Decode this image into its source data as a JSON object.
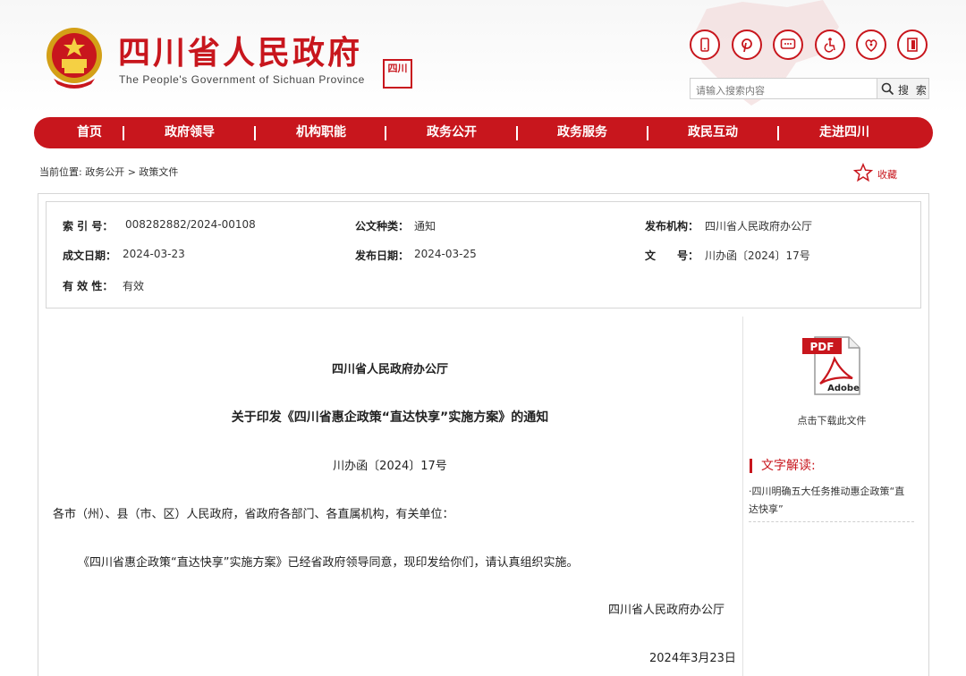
{
  "header": {
    "title": "四川省人民政府",
    "subtitle": "The People's Government of Sichuan Province",
    "seal_text": "四川",
    "icons": [
      "mobile-icon",
      "pinterest-like-icon",
      "message-icon",
      "accessibility-icon",
      "elderly-care-icon",
      "exit-icon"
    ],
    "search_placeholder": "请输入搜索内容",
    "search_label": "搜 索"
  },
  "nav": {
    "items": [
      "首页",
      "政府领导",
      "机构职能",
      "政务公开",
      "政务服务",
      "政民互动",
      "走进四川"
    ]
  },
  "breadcrumb": "当前位置: 政务公开 > 政策文件",
  "favorite_label": "收藏",
  "meta": {
    "index_key": "索 引 号：",
    "index_val": "008282882/2024-00108",
    "type_key": "公文种类：",
    "type_val": "通知",
    "issuer_key": "发布机构：",
    "issuer_val": "四川省人民政府办公厅",
    "written_key": "成文日期：",
    "written_val": "2024-03-23",
    "published_key": "发布日期：",
    "published_val": "2024-03-25",
    "docno_key": "文　　号：",
    "docno_val": "川办函〔2024〕17号",
    "valid_key": "有 效 性：",
    "valid_val": "有效"
  },
  "document": {
    "issuer": "四川省人民政府办公厅",
    "title": "关于印发《四川省惠企政策“直达快享”实施方案》的通知",
    "doc_number": "川办函〔2024〕17号",
    "recipients": "各市（州）、县（市、区）人民政府，省政府各部门、各直属机构，有关单位：",
    "body": "《四川省惠企政策“直达快享”实施方案》已经省政府领导同意，现印发给你们，请认真组织实施。",
    "signature": "四川省人民政府办公厅",
    "date": "2024年3月23日"
  },
  "sidebar": {
    "pdf_badge": "PDF",
    "pdf_brand": "Adobe",
    "download_label": "点击下载此文件",
    "interpretation_title": "文字解读:",
    "interpretation_link": "·四川明确五大任务推动惠企政策“直达快享”"
  },
  "colors": {
    "brand_red": "#c8161d"
  }
}
